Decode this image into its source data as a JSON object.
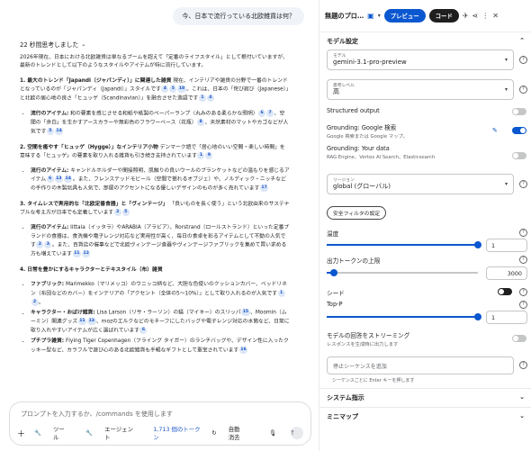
{
  "chat": {
    "user_message": "今、日本で流行っている北欧雑貨は何？",
    "thinking_label": "22 秒間思考しました",
    "intro": "2026年現在、日本における北欧雑貨は単なるブームを超えて「定番のライフスタイル」として根付いていますが、最新のトレンドとして以下のようなスタイルやアイテムが特に流行しています。",
    "sections": [
      {
        "heading": "1. 最大のトレンド「Japandi（ジャパンディ）」に関連した雑貨",
        "heading_rest": " 現在、インテリアや雑貨の分野で一番のトレンドとなっているのが「ジャパンディ（Japandi）」スタイルです",
        "heading_cites": [
          "4",
          "5",
          "18"
        ],
        "heading_tail": "。これは、日本の「侘び寂び（Japanese）」と北欧の居心地の良さ「ヒュッゲ（Scandinavian）」を融合させた造語です",
        "heading_tail_cites": [
          "1",
          "4"
        ],
        "items": [
          {
            "lead": "流行のアイテム:",
            "text": " 和の要素を感じさせる和紙や紙製のペーパーランプ（丸みのある柔らかな照明）",
            "cites": [
              "6",
              "7"
            ],
            "text2": "、空間の「余白」を生かすアースカラーや無彩色のフラワーベース（花瓶）",
            "cites2": [
              "8"
            ],
            "text3": "、天然素材のマットやカゴなどが人気です",
            "cites3": [
              "5",
              "14"
            ]
          }
        ]
      },
      {
        "heading": "2. 空間を癒やす「ヒュッゲ（Hygge）」なインテリア小物",
        "heading_rest": " デンマーク語で「居心地のいい空間・楽しい時間」を意味する「ヒュッゲ」の要素を取り入れる雑貨も引き続き支持されています",
        "heading_cites": [
          "1",
          "9"
        ],
        "heading_tail": "",
        "heading_tail_cites": [],
        "items": [
          {
            "lead": "流行のアイテム:",
            "text": " キャンドルホルダーや間接照明、肌触りの良いウールのブランケットなどの温もりを感じるアイテム",
            "cites": [
              "6",
              "13",
              "14"
            ],
            "text2": "。また、フレンステッドモビール（空間で揺れるオブジェ）や、ノルディック・ニッチなどの手作りの木製玩具も人気で、部屋のアクセントになる優しいデザインのものが多く売れています",
            "cites2": [
              "17"
            ],
            "text3": "",
            "cites3": []
          }
        ]
      },
      {
        "heading": "3. タイムレスで実用的な「北欧定番食器」と「ヴィンテージ」",
        "heading_rest": " 「良いものを長く使う」という北欧由来のサステナブルな考え方が日本でも定着しています",
        "heading_cites": [
          "2",
          "5"
        ],
        "heading_tail": "",
        "heading_tail_cites": [],
        "items": [
          {
            "lead": "流行のアイテム:",
            "text": " Iittala（イッタラ）やARABIA（アラビア）、Rorstrand（ロールストランド）といった定番ブランドの食器は、食洗機や電子レンジ対応など実用性が高く、毎日の食卓を彩るアイテムとして不動の人気です",
            "cites": [
              "2",
              "3"
            ],
            "text2": "。また、百貨店の催事などで北欧ヴィンテージ食器やヴィンテージファブリックを集めて買い求める方も増えています",
            "cites2": [
              "11",
              "12"
            ],
            "text3": "",
            "cites3": []
          }
        ]
      },
      {
        "heading": "4. 日常を豊かにするキャラクターとテキスタイル（布）雑貨",
        "heading_rest": "",
        "heading_cites": [],
        "heading_tail": "",
        "heading_tail_cites": [],
        "items": [
          {
            "lead": "ファブリック:",
            "text": " Marimekko（マリメッコ）のウニッコ柄など、大胆な色使いのクッションカバー、ベッドリネン（布団などのカバー）をインテリアの「アクセント（全体の5〜10%）」として取り入れるのが人気です",
            "cites": [
              "1",
              "2"
            ],
            "text2": "。",
            "cites2": [],
            "text3": "",
            "cites3": []
          },
          {
            "lead": "キャラクター・おばけ雑貨:",
            "text": " Lisa Larson（リサ・ラーソン）の猫（マイキー）のスリッパ",
            "cites": [
              "15"
            ],
            "text2": "、Moomin（ムーミン）関連グッズ",
            "cites2": [
              "11",
              "13"
            ],
            "text3": "、mozのエルクなどのモチーフにしたバッグや電子レンジ対応の水筒など、日常に取り入れやすいアイテムが広く選ばれています",
            "cites3": [
              "6"
            ]
          },
          {
            "lead": "プチプラ雑貨:",
            "text": " Flying Tiger Copenhagen（フライング タイガー）のランチバッグや、デザイン性に入ったクッキー型など、カラフルで遊び心のある北欧雑貨も手軽なギフトとして重宝されています",
            "cites": [
              "16"
            ],
            "text2": "",
            "cites2": [],
            "text3": "",
            "cites3": []
          }
        ]
      }
    ]
  },
  "composer": {
    "placeholder": "プロンプトを入力するか、/commands を使用します",
    "tools_label": "ツール",
    "agent_label": "エージェント",
    "tokens_label": "1,713 個のトークン",
    "autosave_label": "自動消去"
  },
  "panel": {
    "title": "無題のプロ…",
    "preview_label": "プレビュー",
    "code_label": "コード",
    "model_settings": "モデル設定",
    "model": {
      "label": "モデル",
      "value": "gemini-3.1-pro-preview"
    },
    "thinking": {
      "label": "思考レベル",
      "value": "高"
    },
    "structured_output": "Structured output",
    "grounding_google": {
      "title": "Grounding: Google 検索",
      "sub": "Google 検索または Google マップ。"
    },
    "grounding_data": {
      "title": "Grounding: Your data",
      "sub": "RAG Engine、Vertex AI Search、Elasticsearch"
    },
    "region": {
      "label": "リージョン",
      "value": "global (グローバル)"
    },
    "safety_button": "安全フィルタの設定",
    "temperature": {
      "label": "温度",
      "value": "1",
      "fraction": 1.0
    },
    "max_tokens": {
      "label": "出力トークンの上限",
      "value": "3000",
      "fraction": 0.05
    },
    "seed": "シード",
    "top_p": {
      "label": "Top-P",
      "value": "1",
      "fraction": 1.0
    },
    "streaming": {
      "title": "モデルの回答をストリーミング",
      "sub": "レスポンスを生成時に出力します"
    },
    "stop_sequence": {
      "placeholder": "停止シーケンスを追加",
      "hint": "シーケンスごとに Enter キーを押します"
    },
    "system_instructions": "システム指示",
    "minimap": "ミニマップ",
    "accent": "#0b57d0"
  }
}
